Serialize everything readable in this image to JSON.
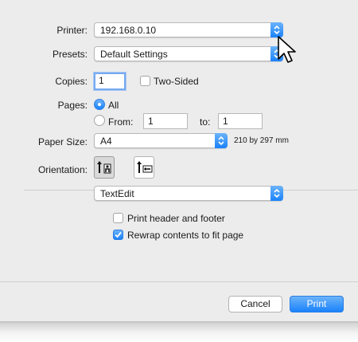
{
  "printer": {
    "label": "Printer:",
    "value": "192.168.0.10"
  },
  "presets": {
    "label": "Presets:",
    "value": "Default Settings"
  },
  "copies": {
    "label": "Copies:",
    "value": "1",
    "two_sided_label": "Two-Sided",
    "two_sided_checked": false
  },
  "pages": {
    "label": "Pages:",
    "all_label": "All",
    "from_label": "From:",
    "from_value": "1",
    "to_label": "to:",
    "to_value": "1",
    "selected": "All"
  },
  "paper_size": {
    "label": "Paper Size:",
    "value": "A4",
    "dimensions": "210 by 297 mm"
  },
  "orientation": {
    "label": "Orientation:",
    "selected": "portrait"
  },
  "app_menu": {
    "value": "TextEdit"
  },
  "options": {
    "print_header_footer_label": "Print header and footer",
    "print_header_footer_checked": false,
    "rewrap_label": "Rewrap contents to fit page",
    "rewrap_checked": true
  },
  "buttons": {
    "cancel": "Cancel",
    "print": "Print"
  },
  "colors": {
    "accent": "#1a82fb",
    "dialog_bg": "#ececec"
  },
  "icons": [
    "up-down-arrows-icon",
    "checkmark-icon",
    "portrait-orientation-icon",
    "landscape-orientation-icon",
    "mouse-pointer-icon"
  ]
}
